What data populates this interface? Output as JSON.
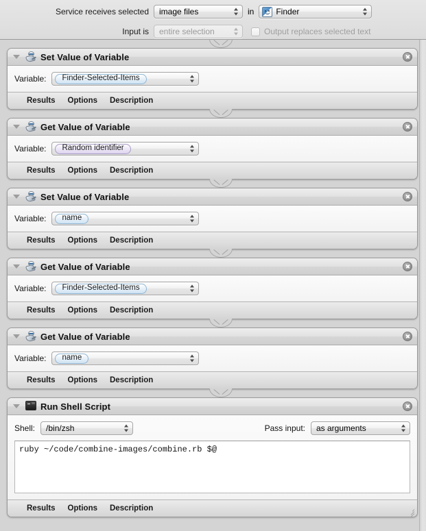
{
  "header": {
    "receives_label": "Service receives selected",
    "receives_value": "image files",
    "in_word": "in",
    "app_value": "Finder",
    "app_icon": "finder-icon",
    "input_is_label": "Input is",
    "input_is_value": "entire selection",
    "output_replaces_label": "Output replaces selected text",
    "output_replaces_checked": false
  },
  "footer_links": {
    "results": "Results",
    "options": "Options",
    "description": "Description"
  },
  "common": {
    "variable_label": "Variable:"
  },
  "actions": [
    {
      "title": "Set Value of Variable",
      "icon": "automator-robot-icon",
      "variable": "Finder-Selected-Items",
      "token_color": "blue"
    },
    {
      "title": "Get Value of Variable",
      "icon": "automator-robot-icon",
      "variable": "Random identifier",
      "token_color": "purple"
    },
    {
      "title": "Set Value of Variable",
      "icon": "automator-robot-icon",
      "variable": "name",
      "token_color": "blue"
    },
    {
      "title": "Get Value of Variable",
      "icon": "automator-robot-icon",
      "variable": "Finder-Selected-Items",
      "token_color": "blue"
    },
    {
      "title": "Get Value of Variable",
      "icon": "automator-robot-icon",
      "variable": "name",
      "token_color": "blue"
    }
  ],
  "shell_action": {
    "title": "Run Shell Script",
    "icon": "terminal-icon",
    "shell_label": "Shell:",
    "shell_value": "/bin/zsh",
    "pass_input_label": "Pass input:",
    "pass_input_value": "as arguments",
    "script": "ruby ~/code/combine-images/combine.rb $@"
  },
  "colors": {
    "canvas_bg": "#d4d4d4",
    "token_blue_border": "#8fb6d4",
    "token_purple_border": "#a99cc6",
    "action_border": "#9b9b9b"
  }
}
